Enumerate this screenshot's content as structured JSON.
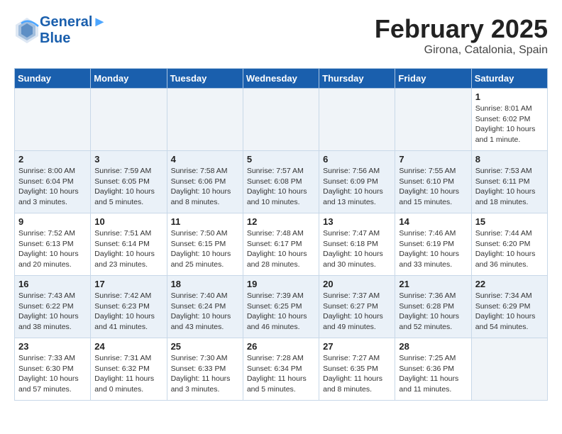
{
  "header": {
    "logo_line1": "General",
    "logo_line2": "Blue",
    "month_title": "February 2025",
    "location": "Girona, Catalonia, Spain"
  },
  "days_of_week": [
    "Sunday",
    "Monday",
    "Tuesday",
    "Wednesday",
    "Thursday",
    "Friday",
    "Saturday"
  ],
  "weeks": [
    {
      "alt": false,
      "days": [
        {
          "num": "",
          "info": ""
        },
        {
          "num": "",
          "info": ""
        },
        {
          "num": "",
          "info": ""
        },
        {
          "num": "",
          "info": ""
        },
        {
          "num": "",
          "info": ""
        },
        {
          "num": "",
          "info": ""
        },
        {
          "num": "1",
          "info": "Sunrise: 8:01 AM\nSunset: 6:02 PM\nDaylight: 10 hours\nand 1 minute."
        }
      ]
    },
    {
      "alt": true,
      "days": [
        {
          "num": "2",
          "info": "Sunrise: 8:00 AM\nSunset: 6:04 PM\nDaylight: 10 hours\nand 3 minutes."
        },
        {
          "num": "3",
          "info": "Sunrise: 7:59 AM\nSunset: 6:05 PM\nDaylight: 10 hours\nand 5 minutes."
        },
        {
          "num": "4",
          "info": "Sunrise: 7:58 AM\nSunset: 6:06 PM\nDaylight: 10 hours\nand 8 minutes."
        },
        {
          "num": "5",
          "info": "Sunrise: 7:57 AM\nSunset: 6:08 PM\nDaylight: 10 hours\nand 10 minutes."
        },
        {
          "num": "6",
          "info": "Sunrise: 7:56 AM\nSunset: 6:09 PM\nDaylight: 10 hours\nand 13 minutes."
        },
        {
          "num": "7",
          "info": "Sunrise: 7:55 AM\nSunset: 6:10 PM\nDaylight: 10 hours\nand 15 minutes."
        },
        {
          "num": "8",
          "info": "Sunrise: 7:53 AM\nSunset: 6:11 PM\nDaylight: 10 hours\nand 18 minutes."
        }
      ]
    },
    {
      "alt": false,
      "days": [
        {
          "num": "9",
          "info": "Sunrise: 7:52 AM\nSunset: 6:13 PM\nDaylight: 10 hours\nand 20 minutes."
        },
        {
          "num": "10",
          "info": "Sunrise: 7:51 AM\nSunset: 6:14 PM\nDaylight: 10 hours\nand 23 minutes."
        },
        {
          "num": "11",
          "info": "Sunrise: 7:50 AM\nSunset: 6:15 PM\nDaylight: 10 hours\nand 25 minutes."
        },
        {
          "num": "12",
          "info": "Sunrise: 7:48 AM\nSunset: 6:17 PM\nDaylight: 10 hours\nand 28 minutes."
        },
        {
          "num": "13",
          "info": "Sunrise: 7:47 AM\nSunset: 6:18 PM\nDaylight: 10 hours\nand 30 minutes."
        },
        {
          "num": "14",
          "info": "Sunrise: 7:46 AM\nSunset: 6:19 PM\nDaylight: 10 hours\nand 33 minutes."
        },
        {
          "num": "15",
          "info": "Sunrise: 7:44 AM\nSunset: 6:20 PM\nDaylight: 10 hours\nand 36 minutes."
        }
      ]
    },
    {
      "alt": true,
      "days": [
        {
          "num": "16",
          "info": "Sunrise: 7:43 AM\nSunset: 6:22 PM\nDaylight: 10 hours\nand 38 minutes."
        },
        {
          "num": "17",
          "info": "Sunrise: 7:42 AM\nSunset: 6:23 PM\nDaylight: 10 hours\nand 41 minutes."
        },
        {
          "num": "18",
          "info": "Sunrise: 7:40 AM\nSunset: 6:24 PM\nDaylight: 10 hours\nand 43 minutes."
        },
        {
          "num": "19",
          "info": "Sunrise: 7:39 AM\nSunset: 6:25 PM\nDaylight: 10 hours\nand 46 minutes."
        },
        {
          "num": "20",
          "info": "Sunrise: 7:37 AM\nSunset: 6:27 PM\nDaylight: 10 hours\nand 49 minutes."
        },
        {
          "num": "21",
          "info": "Sunrise: 7:36 AM\nSunset: 6:28 PM\nDaylight: 10 hours\nand 52 minutes."
        },
        {
          "num": "22",
          "info": "Sunrise: 7:34 AM\nSunset: 6:29 PM\nDaylight: 10 hours\nand 54 minutes."
        }
      ]
    },
    {
      "alt": false,
      "days": [
        {
          "num": "23",
          "info": "Sunrise: 7:33 AM\nSunset: 6:30 PM\nDaylight: 10 hours\nand 57 minutes."
        },
        {
          "num": "24",
          "info": "Sunrise: 7:31 AM\nSunset: 6:32 PM\nDaylight: 11 hours\nand 0 minutes."
        },
        {
          "num": "25",
          "info": "Sunrise: 7:30 AM\nSunset: 6:33 PM\nDaylight: 11 hours\nand 3 minutes."
        },
        {
          "num": "26",
          "info": "Sunrise: 7:28 AM\nSunset: 6:34 PM\nDaylight: 11 hours\nand 5 minutes."
        },
        {
          "num": "27",
          "info": "Sunrise: 7:27 AM\nSunset: 6:35 PM\nDaylight: 11 hours\nand 8 minutes."
        },
        {
          "num": "28",
          "info": "Sunrise: 7:25 AM\nSunset: 6:36 PM\nDaylight: 11 hours\nand 11 minutes."
        },
        {
          "num": "",
          "info": ""
        }
      ]
    }
  ]
}
